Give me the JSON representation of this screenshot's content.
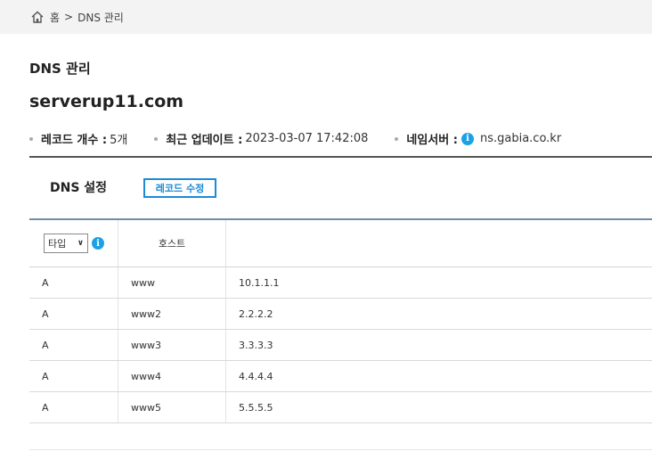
{
  "breadcrumb": {
    "home": "홈",
    "separator": ">",
    "current": "DNS 관리"
  },
  "page_title": "DNS 관리",
  "domain": "serverup11.com",
  "meta": {
    "record_count_label": "레코드 개수 :",
    "record_count_value": "5개",
    "updated_label": "최근 업데이트 :",
    "updated_value": "2023-03-07 17:42:08",
    "nameserver_label": "네임서버 :",
    "nameserver_value": "ns.gabia.co.kr"
  },
  "settings": {
    "title": "DNS 설정",
    "edit_button": "레코드 수정"
  },
  "table": {
    "type_select": "타입",
    "host_header": "호스트",
    "rows": [
      {
        "type": "A",
        "host": "www",
        "value": "10.1.1.1"
      },
      {
        "type": "A",
        "host": "www2",
        "value": "2.2.2.2"
      },
      {
        "type": "A",
        "host": "www3",
        "value": "3.3.3.3"
      },
      {
        "type": "A",
        "host": "www4",
        "value": "4.4.4.4"
      },
      {
        "type": "A",
        "host": "www5",
        "value": "5.5.5.5"
      }
    ]
  },
  "icons": {
    "home": "home-icon",
    "info": "info-icon",
    "chevron": "chevron-down-icon"
  },
  "colors": {
    "accent": "#1c8ad4",
    "info": "#1ba1e6"
  }
}
